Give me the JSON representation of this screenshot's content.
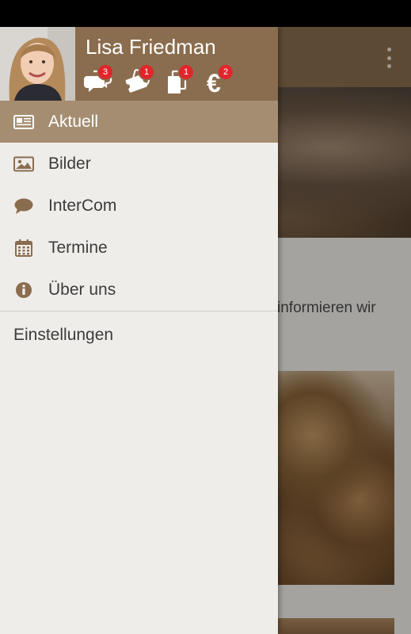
{
  "user": {
    "name": "Lisa Friedman"
  },
  "badges": [
    {
      "icon": "chat-bubbles-icon",
      "count": "3"
    },
    {
      "icon": "tickets-icon",
      "count": "1"
    },
    {
      "icon": "documents-icon",
      "count": "1"
    },
    {
      "icon": "euro-icon",
      "count": "2"
    }
  ],
  "menu": {
    "items": [
      {
        "label": "Aktuell",
        "icon": "newspaper-icon",
        "active": true
      },
      {
        "label": "Bilder",
        "icon": "image-icon",
        "active": false
      },
      {
        "label": "InterCom",
        "icon": "speech-bubble-icon",
        "active": false
      },
      {
        "label": "Termine",
        "icon": "calendar-icon",
        "active": false
      },
      {
        "label": "Über uns",
        "icon": "info-icon",
        "active": false
      }
    ],
    "settings_label": "Einstellungen"
  },
  "background": {
    "partial_text": "informieren wir"
  },
  "colors": {
    "header_brown": "#8a6d4e",
    "active_item": "#a58d72",
    "icon_brown": "#8a6d4e",
    "badge_red": "#e0262b",
    "drawer_bg": "#efedea"
  }
}
